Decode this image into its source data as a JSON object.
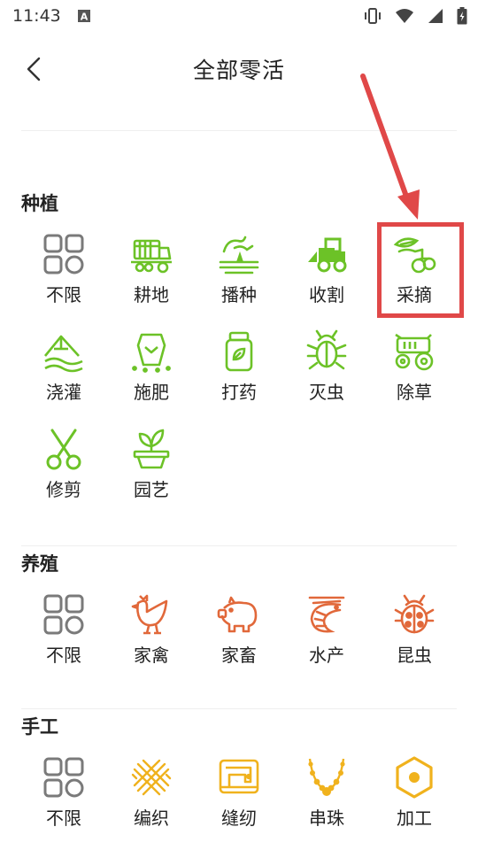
{
  "status": {
    "time": "11:43"
  },
  "header": {
    "title": "全部零活",
    "back": "back-arrow-icon"
  },
  "colors": {
    "green": "#6cc227",
    "orange": "#e1683a",
    "yellow": "#f0b21d",
    "gray": "#7a7a7a",
    "highlight": "#e04848"
  },
  "sections": [
    {
      "title": "种植",
      "items": [
        {
          "label": "不限",
          "icon": "grid-icon"
        },
        {
          "label": "耕地",
          "icon": "harvester-icon"
        },
        {
          "label": "播种",
          "icon": "sowing-icon"
        },
        {
          "label": "收割",
          "icon": "tractor-icon"
        },
        {
          "label": "采摘",
          "icon": "picking-icon"
        },
        {
          "label": "浇灌",
          "icon": "irrigation-icon"
        },
        {
          "label": "施肥",
          "icon": "fertilizer-icon"
        },
        {
          "label": "打药",
          "icon": "pesticide-icon"
        },
        {
          "label": "灭虫",
          "icon": "bug-icon"
        },
        {
          "label": "除草",
          "icon": "mower-icon"
        },
        {
          "label": "修剪",
          "icon": "scissors-icon"
        },
        {
          "label": "园艺",
          "icon": "plant-pot-icon"
        }
      ]
    },
    {
      "title": "养殖",
      "items": [
        {
          "label": "不限",
          "icon": "grid-icon"
        },
        {
          "label": "家禽",
          "icon": "chicken-icon"
        },
        {
          "label": "家畜",
          "icon": "pig-icon"
        },
        {
          "label": "水产",
          "icon": "shrimp-icon"
        },
        {
          "label": "昆虫",
          "icon": "ladybug-icon"
        }
      ]
    },
    {
      "title": "手工",
      "items": [
        {
          "label": "不限",
          "icon": "grid-icon"
        },
        {
          "label": "编织",
          "icon": "weaving-icon"
        },
        {
          "label": "缝纫",
          "icon": "sewing-machine-icon"
        },
        {
          "label": "串珠",
          "icon": "beads-icon"
        },
        {
          "label": "加工",
          "icon": "hex-nut-icon"
        }
      ]
    }
  ]
}
